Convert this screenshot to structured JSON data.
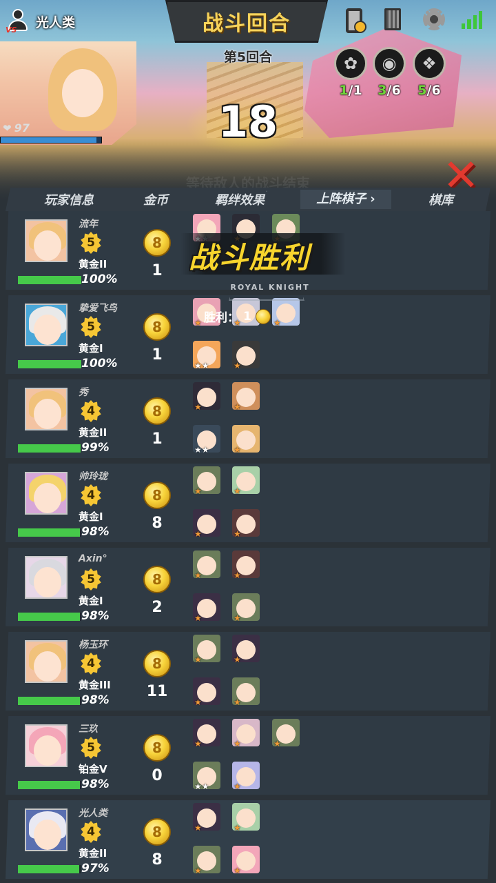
{
  "top_user": {
    "name": "光人类",
    "hp": "97"
  },
  "title": "战斗回合",
  "round": "第5回合",
  "timer": "18",
  "synergies": [
    {
      "icon": "flower-icon",
      "glyph": "✿",
      "current": "1",
      "total": "1"
    },
    {
      "icon": "eye-icon",
      "glyph": "◉",
      "current": "3",
      "total": "6"
    },
    {
      "icon": "scroll-icon",
      "glyph": "❖",
      "current": "5",
      "total": "6"
    }
  ],
  "faded_caption": "等待敌人的战斗结束",
  "tabs": [
    "玩家信息",
    "金币",
    "羁绊效果",
    "上阵棋子",
    "棋库"
  ],
  "active_tab_chevron": "›",
  "victory": {
    "text": "战斗胜利",
    "brand": "ROYAL KNIGHT",
    "win_label": "胜利：",
    "win_count": "1"
  },
  "coin_symbol": "8",
  "players": [
    {
      "name": "流年",
      "level": "5",
      "rank": "黄金II",
      "pct": "100%",
      "xp": 1.0,
      "gold": "1",
      "hair": "#f1c27b",
      "bg": "#f3c3a2",
      "stars": [
        "white",
        "orange",
        "orange"
      ]
    },
    {
      "name": "挚爱飞鸟",
      "level": "5",
      "rank": "黄金I",
      "pct": "100%",
      "xp": 1.0,
      "gold": "1",
      "hair": "#e9e9e9",
      "bg": "#4aa7d8",
      "stars": [
        "orange",
        "orange",
        "orange",
        "white",
        "orange"
      ]
    },
    {
      "name": "秀",
      "level": "4",
      "rank": "黄金II",
      "pct": "99%",
      "xp": 0.99,
      "gold": "1",
      "hair": "#f1c27b",
      "bg": "#f3c3a2",
      "stars": [
        "orange",
        "orange",
        "white",
        "orange"
      ]
    },
    {
      "name": "帅玲珑",
      "level": "4",
      "rank": "黄金I",
      "pct": "98%",
      "xp": 0.98,
      "gold": "8",
      "hair": "#f4d36b",
      "bg": "#d6a6d8",
      "stars": [
        "orange",
        "orange",
        "orange",
        "orange"
      ]
    },
    {
      "name": "Axin°",
      "level": "5",
      "rank": "黄金I",
      "pct": "98%",
      "xp": 0.98,
      "gold": "2",
      "hair": "#d9d9df",
      "bg": "#e7d7e8",
      "stars": [
        "orange",
        "orange",
        "orange",
        "orange"
      ]
    },
    {
      "name": "杨玉环",
      "level": "4",
      "rank": "黄金III",
      "pct": "98%",
      "xp": 0.98,
      "gold": "11",
      "hair": "#f1c27b",
      "bg": "#f3c3a2",
      "stars": [
        "orange",
        "orange",
        "orange",
        "orange"
      ]
    },
    {
      "name": "三玖",
      "level": "5",
      "rank": "铂金V",
      "pct": "98%",
      "xp": 0.98,
      "gold": "0",
      "hair": "#f4a6b8",
      "bg": "#f6d0d8",
      "stars": [
        "orange",
        "orange",
        "orange",
        "white",
        "orange"
      ]
    },
    {
      "name": "光人类",
      "level": "4",
      "rank": "黄金II",
      "pct": "97%",
      "xp": 0.97,
      "gold": "8",
      "hair": "#e9e9f3",
      "bg": "#5a6fb0",
      "stars": [
        "orange",
        "orange",
        "orange",
        "orange"
      ]
    }
  ]
}
